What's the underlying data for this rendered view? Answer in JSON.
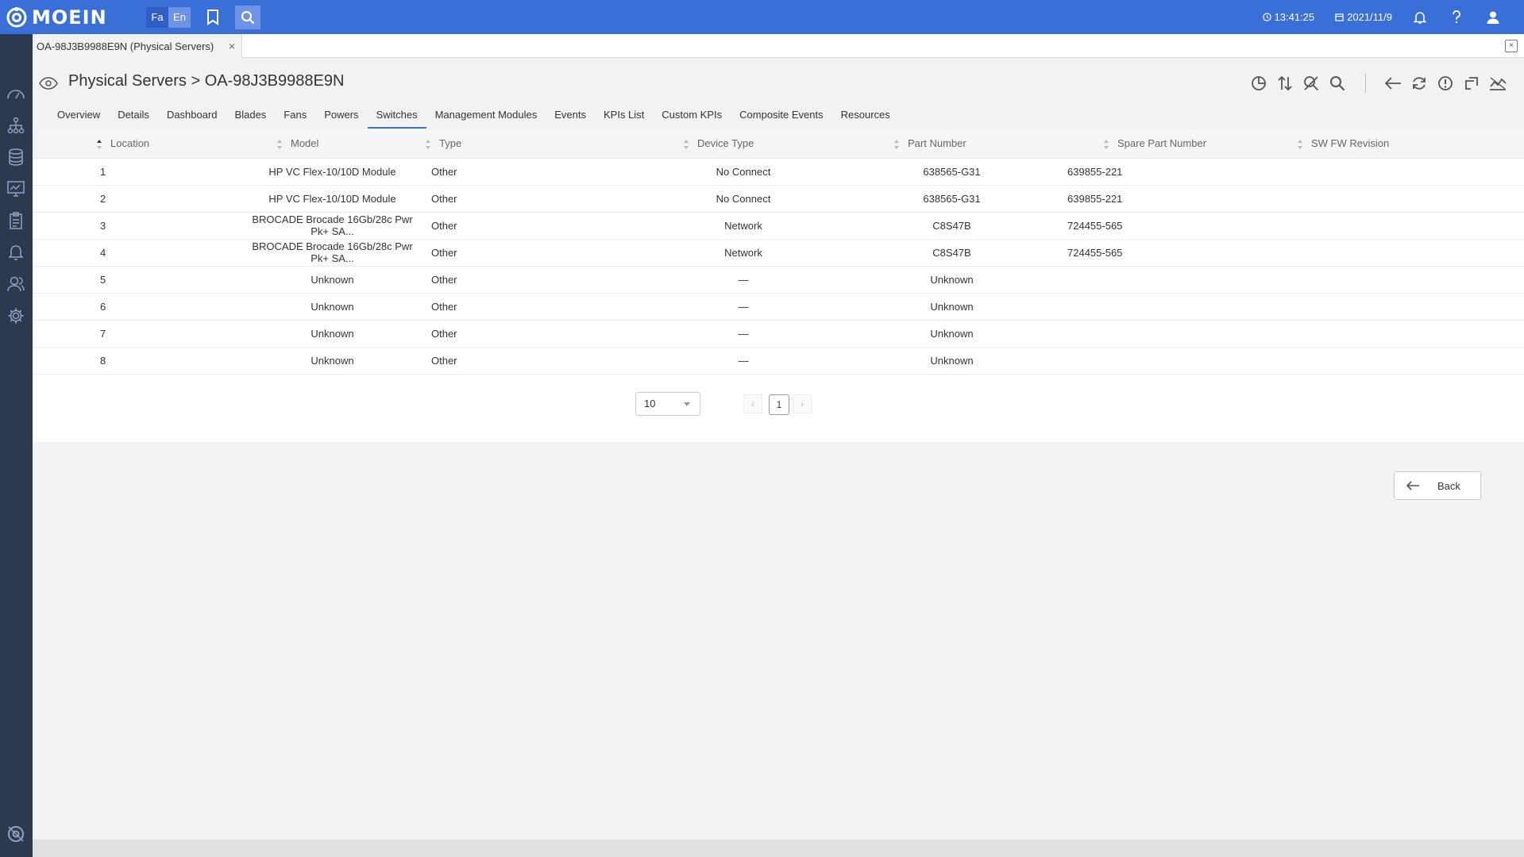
{
  "app": {
    "logo_text": "MOEIN"
  },
  "topbar": {
    "lang_fa": "Fa",
    "lang_en": "En",
    "time": "13:41:25",
    "date": "2021/11/9"
  },
  "open_tab": {
    "label": "OA-98J3B9988E9N (Physical Servers)",
    "close": "×"
  },
  "header": {
    "title": "Physical Servers > OA-98J3B9988E9N"
  },
  "nav_tabs": [
    {
      "label": "Overview",
      "active": false
    },
    {
      "label": "Details",
      "active": false
    },
    {
      "label": "Dashboard",
      "active": false
    },
    {
      "label": "Blades",
      "active": false
    },
    {
      "label": "Fans",
      "active": false
    },
    {
      "label": "Powers",
      "active": false
    },
    {
      "label": "Switches",
      "active": true
    },
    {
      "label": "Management Modules",
      "active": false
    },
    {
      "label": "Events",
      "active": false
    },
    {
      "label": "KPIs List",
      "active": false
    },
    {
      "label": "Custom KPIs",
      "active": false
    },
    {
      "label": "Composite Events",
      "active": false
    },
    {
      "label": "Resources",
      "active": false
    }
  ],
  "table": {
    "columns": [
      "Location",
      "Model",
      "Type",
      "Device Type",
      "Part Number",
      "Spare Part Number",
      "SW FW Revision"
    ],
    "rows": [
      [
        "1",
        "HP VC Flex-10/10D Module",
        "Other",
        "No Connect",
        "638565-G31",
        "639855-221",
        ""
      ],
      [
        "2",
        "HP VC Flex-10/10D Module",
        "Other",
        "No Connect",
        "638565-G31",
        "639855-221",
        ""
      ],
      [
        "3",
        "BROCADE Brocade 16Gb/28c Pwr Pk+ SA...",
        "Other",
        "Network",
        "C8S47B",
        "724455-565",
        ""
      ],
      [
        "4",
        "BROCADE Brocade 16Gb/28c Pwr Pk+ SA...",
        "Other",
        "Network",
        "C8S47B",
        "724455-565",
        ""
      ],
      [
        "5",
        "Unknown",
        "Other",
        "—",
        "Unknown",
        "",
        ""
      ],
      [
        "6",
        "Unknown",
        "Other",
        "—",
        "Unknown",
        "",
        ""
      ],
      [
        "7",
        "Unknown",
        "Other",
        "—",
        "Unknown",
        "",
        ""
      ],
      [
        "8",
        "Unknown",
        "Other",
        "—",
        "Unknown",
        "",
        ""
      ]
    ]
  },
  "pagination": {
    "page_size": "10",
    "current_page": "1"
  },
  "back_button": {
    "label": "Back"
  },
  "colors": {
    "topbar": "#3a6fd8",
    "sidebar": "#2c3a4f",
    "accent": "#3a6fd8"
  }
}
